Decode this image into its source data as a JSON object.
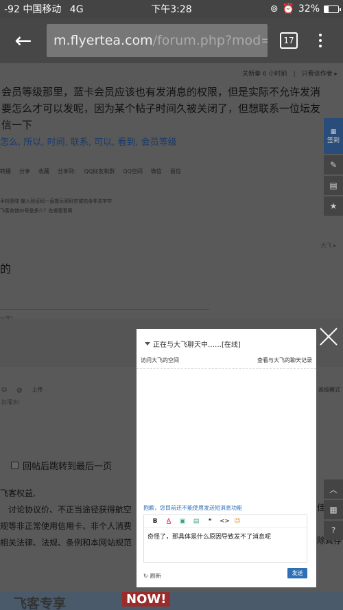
{
  "status": {
    "signal": "-92",
    "carrier": "中国移动",
    "network": "4G",
    "time": "下午3:28",
    "battery": "32%",
    "battery_level": 0.32
  },
  "browser": {
    "url_host": "m.flyertea.com",
    "url_path": "/forum.php?mod=vi",
    "tab_count": "17"
  },
  "page": {
    "meta": "关新秦 6 小时前　|　只看该作者 ▸",
    "post_lines": [
      "会员等级那里，蓝卡会员应该也有发消息的权限，但是实际不允许发消",
      "要怎么才可以发呢，因为某个帖子时间久被关闭了，但想联系一位坛友",
      "信一下"
    ],
    "tags": [
      "怎么",
      "所以",
      "时间",
      "联系",
      "可以",
      "看到",
      "会员等级"
    ],
    "share": [
      "转播",
      "分享",
      "收藏",
      "分享到:",
      "QQ好友和群",
      "QQ空间",
      "微信",
      "易信"
    ],
    "related": [
      "手机登陆 输入验证码一直提示密码空或包含非法字符",
      "飞客茶馆ID号是多少？在哪里看啊"
    ],
    "author_tag": "大飞 ▸",
    "reply_line": "的",
    "reply_small": "一天!",
    "editor_bar": [
      "☺",
      "@",
      "上传",
      "高级模式"
    ],
    "editor_placeholder": "扣灌水!",
    "jump_label": "回帖后跳转到最后一页",
    "rules": [
      "飞客权益,",
      "　讨论协议价、不正当途径获得航空",
      "规等非正常使用信用卡、非个人消费",
      "相关法律、法规、条例和本网站规范"
    ],
    "rules_tail": [
      "佳",
      "删除其存"
    ],
    "banner_text": "飞客专享",
    "banner_badge": "NOW!"
  },
  "side_tools": {
    "sign": "签到",
    "items": [
      "✎",
      "▤",
      "★"
    ],
    "bottom": [
      "︿",
      "▦",
      "?"
    ]
  },
  "chat": {
    "title": "正在与大飞聊天中……[在线]",
    "visit_link": "访问大飞的空间",
    "history_link": "查看与大飞的聊天记录",
    "warning": "抱歉，您目前还不能使用发送短消息功能",
    "tools": [
      "B",
      "A",
      "▣",
      "▤",
      "❝",
      "<>",
      "☺"
    ],
    "message": "奇怪了，那具体是什么原因导致发不了消息呢",
    "refresh": "刷新",
    "send": "发送"
  }
}
